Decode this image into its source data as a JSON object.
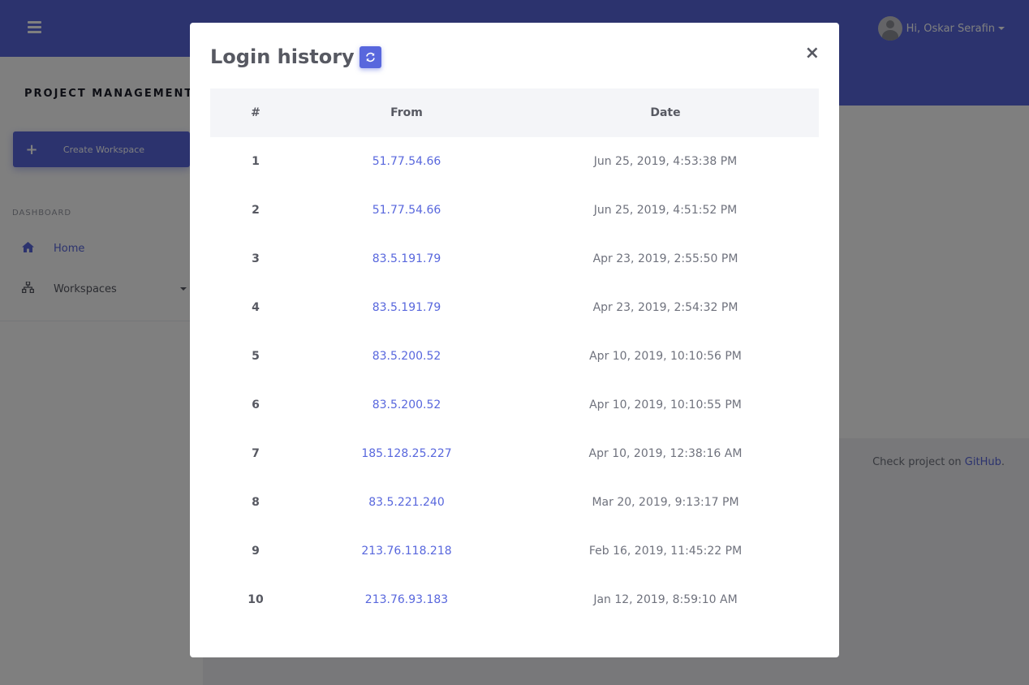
{
  "app": {
    "user_greeting": "Hi, Oskar Serafin",
    "brand": "PROJECT MANAGEMENT",
    "create_workspace_label": "Create Workspace",
    "section_label": "DASHBOARD",
    "nav": [
      {
        "label": "Home",
        "icon": "home-icon"
      },
      {
        "label": "Workspaces",
        "icon": "sitemap-icon"
      }
    ],
    "footer_text": "Check project on ",
    "footer_link": "GitHub",
    "footer_end": "."
  },
  "modal": {
    "title": "Login history",
    "close_label": "×",
    "columns": [
      "#",
      "From",
      "Date"
    ],
    "rows": [
      {
        "num": "1",
        "from": "51.77.54.66",
        "date": "Jun 25, 2019, 4:53:38 PM"
      },
      {
        "num": "2",
        "from": "51.77.54.66",
        "date": "Jun 25, 2019, 4:51:52 PM"
      },
      {
        "num": "3",
        "from": "83.5.191.79",
        "date": "Apr 23, 2019, 2:55:50 PM"
      },
      {
        "num": "4",
        "from": "83.5.191.79",
        "date": "Apr 23, 2019, 2:54:32 PM"
      },
      {
        "num": "5",
        "from": "83.5.200.52",
        "date": "Apr 10, 2019, 10:10:56 PM"
      },
      {
        "num": "6",
        "from": "83.5.200.52",
        "date": "Apr 10, 2019, 10:10:55 PM"
      },
      {
        "num": "7",
        "from": "185.128.25.227",
        "date": "Apr 10, 2019, 12:38:16 AM"
      },
      {
        "num": "8",
        "from": "83.5.221.240",
        "date": "Mar 20, 2019, 9:13:17 PM"
      },
      {
        "num": "9",
        "from": "213.76.118.218",
        "date": "Feb 16, 2019, 11:45:22 PM"
      },
      {
        "num": "10",
        "from": "213.76.93.183",
        "date": "Jan 12, 2019, 8:59:10 AM"
      }
    ]
  },
  "colors": {
    "brand": "#5867dd",
    "backdrop": "rgba(0,0,0,0.5)"
  }
}
